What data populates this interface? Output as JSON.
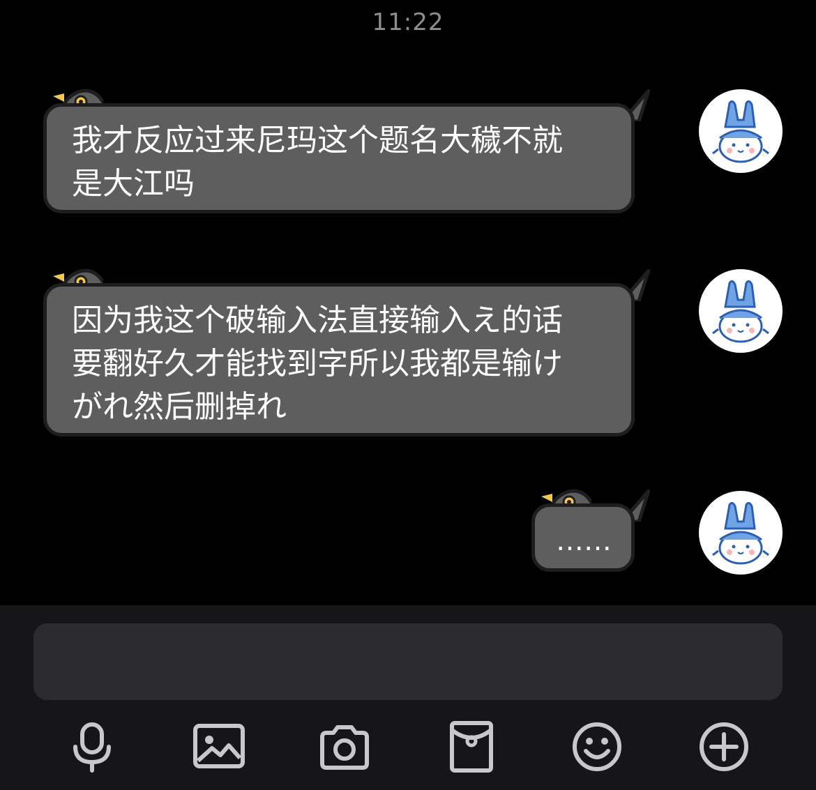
{
  "status": {
    "time": "11:22"
  },
  "messages": [
    {
      "lines": [
        "我才反应过来尼玛这个题名大穢不就",
        "是大江吗"
      ]
    },
    {
      "lines": [
        "因为我这个破输入法直接输入え的话",
        "要翻好久才能找到字所以我都是输け",
        "がれ然后删掉れ"
      ]
    },
    {
      "lines": [
        "……"
      ]
    }
  ],
  "colors": {
    "bubble": "#5e5e5e",
    "avatar_hat": "#6fa3e6"
  },
  "toolbar": {
    "icons": [
      "microphone-icon",
      "image-icon",
      "camera-icon",
      "red-packet-icon",
      "emoji-icon",
      "plus-icon"
    ]
  }
}
